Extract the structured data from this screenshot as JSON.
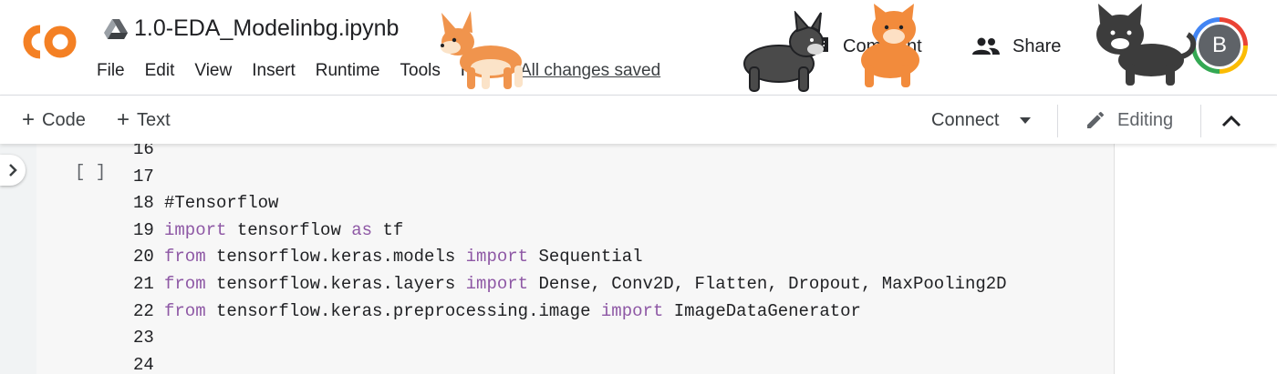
{
  "header": {
    "logo": "colab-logo",
    "drive_icon": "google-drive-icon",
    "title": "1.0-EDA_Modelinbg.ipynb",
    "menu": [
      "File",
      "Edit",
      "View",
      "Insert",
      "Runtime",
      "Tools",
      "Help"
    ],
    "save_status": "All changes saved",
    "comment": {
      "icon": "comment-icon",
      "label": "Comment"
    },
    "share": {
      "icon": "people-icon",
      "label": "Share"
    },
    "avatar_letter": "B"
  },
  "toolbar": {
    "add_code": "Code",
    "add_text": "Text",
    "connect": "Connect",
    "editing": "Editing"
  },
  "cell": {
    "run_indicator": "[ ]",
    "lines": [
      {
        "n": "16",
        "tokens": []
      },
      {
        "n": "17",
        "tokens": []
      },
      {
        "n": "18",
        "tokens": [
          {
            "t": "#Tensorflow",
            "k": "cm"
          }
        ]
      },
      {
        "n": "19",
        "tokens": [
          {
            "t": "import",
            "k": "kw"
          },
          {
            "t": " tensorflow ",
            "k": ""
          },
          {
            "t": "as",
            "k": "kw"
          },
          {
            "t": " tf",
            "k": ""
          }
        ]
      },
      {
        "n": "20",
        "tokens": [
          {
            "t": "from",
            "k": "kw"
          },
          {
            "t": " tensorflow.keras.models ",
            "k": ""
          },
          {
            "t": "import",
            "k": "kw"
          },
          {
            "t": " Sequential",
            "k": ""
          }
        ]
      },
      {
        "n": "21",
        "tokens": [
          {
            "t": "from",
            "k": "kw"
          },
          {
            "t": " tensorflow.keras.layers ",
            "k": ""
          },
          {
            "t": "import",
            "k": "kw"
          },
          {
            "t": " Dense, Conv2D, Flatten, Dropout, MaxPooling2D",
            "k": ""
          }
        ]
      },
      {
        "n": "22",
        "tokens": [
          {
            "t": "from",
            "k": "kw"
          },
          {
            "t": " tensorflow.keras.preprocessing.image ",
            "k": ""
          },
          {
            "t": "import",
            "k": "kw"
          },
          {
            "t": " ImageDataGenerator",
            "k": ""
          }
        ]
      },
      {
        "n": "23",
        "tokens": []
      },
      {
        "n": "24",
        "tokens": []
      }
    ]
  },
  "colors": {
    "logo_orange": "#f9ab00",
    "keyword": "#8e58a5",
    "cell_bg": "#f7f7f7"
  }
}
